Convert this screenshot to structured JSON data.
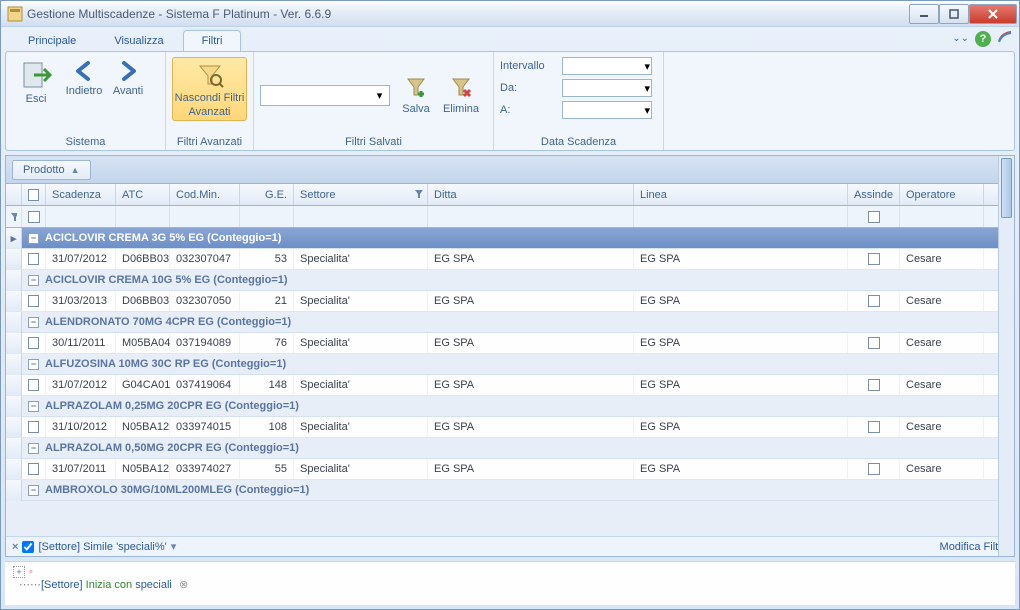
{
  "title": "Gestione Multiscadenze - Sistema F Platinum - Ver. 6.6.9",
  "tabs": {
    "main": "Principale",
    "view": "Visualizza",
    "filters": "Filtri"
  },
  "toolbar_right": {
    "expand_symbol": "⌃"
  },
  "ribbon": {
    "sistema": {
      "label": "Sistema",
      "esci": "Esci",
      "indietro": "Indietro",
      "avanti": "Avanti"
    },
    "filtri_avanzati": {
      "label": "Filtri Avanzati",
      "btn_line1": "Nascondi Filtri",
      "btn_line2": "Avanzati"
    },
    "filtri_salvati": {
      "label": "Filtri Salvati",
      "salva": "Salva",
      "elimina": "Elimina"
    },
    "data_scadenza": {
      "label": "Data Scadenza",
      "intervallo": "Intervallo",
      "da": "Da:",
      "a": "A:"
    }
  },
  "grouping_chip": "Prodotto",
  "columns": {
    "scadenza": "Scadenza",
    "atc": "ATC",
    "codmin": "Cod.Min.",
    "ge": "G.E.",
    "settore": "Settore",
    "ditta": "Ditta",
    "linea": "Linea",
    "assinde": "Assinde",
    "operatore": "Operatore"
  },
  "groups": [
    {
      "title": "ACICLOVIR CREMA  3G 5%  EG (Conteggio=1)",
      "selected": true,
      "rows": [
        {
          "scad": "31/07/2012",
          "atc": "D06BB03",
          "cod": "032307047",
          "ge": "53",
          "set": "Specialita'",
          "ditta": "EG SPA",
          "linea": "EG SPA",
          "op": "Cesare"
        }
      ]
    },
    {
      "title": "ACICLOVIR CREMA 10G 5%  EG (Conteggio=1)",
      "rows": [
        {
          "scad": "31/03/2013",
          "atc": "D06BB03",
          "cod": "032307050",
          "ge": "21",
          "set": "Specialita'",
          "ditta": "EG SPA",
          "linea": "EG SPA",
          "op": "Cesare"
        }
      ]
    },
    {
      "title": "ALENDRONATO 70MG  4CPR  EG (Conteggio=1)",
      "rows": [
        {
          "scad": "30/11/2011",
          "atc": "M05BA04",
          "cod": "037194089",
          "ge": "76",
          "set": "Specialita'",
          "ditta": "EG SPA",
          "linea": "EG SPA",
          "op": "Cesare"
        }
      ]
    },
    {
      "title": "ALFUZOSINA 10MG 30C RP  EG (Conteggio=1)",
      "rows": [
        {
          "scad": "31/07/2012",
          "atc": "G04CA01",
          "cod": "037419064",
          "ge": "148",
          "set": "Specialita'",
          "ditta": "EG SPA",
          "linea": "EG SPA",
          "op": "Cesare"
        }
      ]
    },
    {
      "title": "ALPRAZOLAM 0,25MG 20CPR EG (Conteggio=1)",
      "rows": [
        {
          "scad": "31/10/2012",
          "atc": "N05BA12",
          "cod": "033974015",
          "ge": "108",
          "set": "Specialita'",
          "ditta": "EG SPA",
          "linea": "EG SPA",
          "op": "Cesare"
        }
      ]
    },
    {
      "title": "ALPRAZOLAM 0,50MG 20CPR EG (Conteggio=1)",
      "rows": [
        {
          "scad": "31/07/2011",
          "atc": "N05BA12",
          "cod": "033974027",
          "ge": "55",
          "set": "Specialita'",
          "ditta": "EG SPA",
          "linea": "EG SPA",
          "op": "Cesare"
        }
      ]
    },
    {
      "title": "AMBROXOLO 30MG/10ML200MLEG (Conteggio=1)",
      "rows": []
    }
  ],
  "filter_bar": {
    "text": "[Settore] Simile 'speciali%'",
    "edit": "Modifica Filtro"
  },
  "footer": {
    "field": "[Settore]",
    "op": "Inizia con",
    "val": "speciali"
  }
}
